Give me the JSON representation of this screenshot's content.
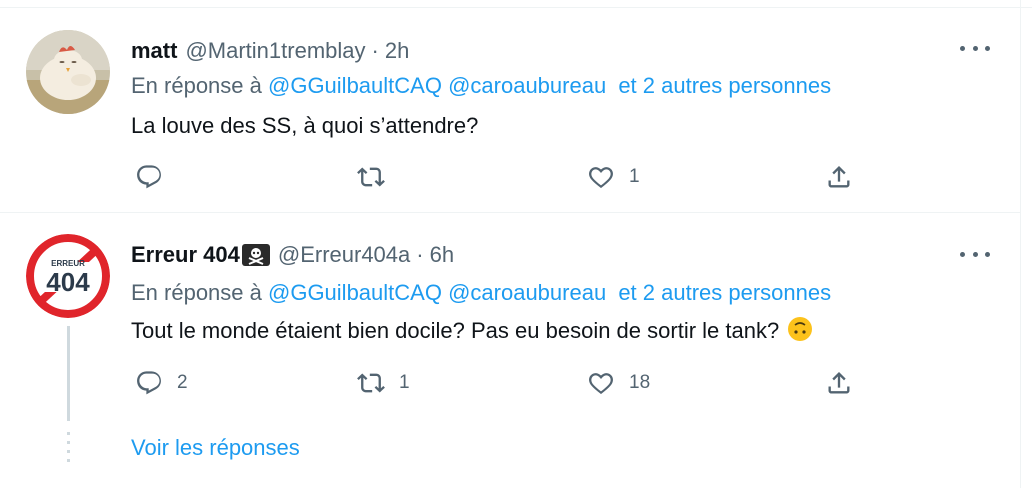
{
  "tweets": [
    {
      "author_name": "matt",
      "handle": "@Martin1tremblay",
      "separator": "·",
      "time": "2h",
      "reply_prefix": "En réponse à",
      "mentions": [
        "@GGuilbaultCAQ",
        "@caroaubureau"
      ],
      "others": "et 2 autres personnes",
      "text": "La louve des SS, à quoi s’attendre?",
      "reply_count": "",
      "retweet_count": "",
      "like_count": "1"
    },
    {
      "author_name": "Erreur 404",
      "handle": "@Erreur404a",
      "separator": "·",
      "time": "6h",
      "reply_prefix": "En réponse à",
      "mentions": [
        "@GGuilbaultCAQ",
        "@caroaubureau"
      ],
      "others": "et 2 autres personnes",
      "text": "Tout le monde étaient bien docile? Pas eu besoin de sortir le tank?",
      "reply_count": "2",
      "retweet_count": "1",
      "like_count": "18",
      "avatar_text_top": "ERREUR",
      "avatar_text_main": "404"
    }
  ],
  "see_replies_label": "Voir les réponses",
  "colors": {
    "accent": "#1d9bf0",
    "secondary_text": "#536471",
    "primary_text": "#0f1419",
    "avatar_red": "#e0252b"
  },
  "icons": [
    "reply-icon",
    "retweet-icon",
    "like-icon",
    "share-icon",
    "more-icon",
    "skull-flag-icon",
    "upside-down-face-icon"
  ]
}
